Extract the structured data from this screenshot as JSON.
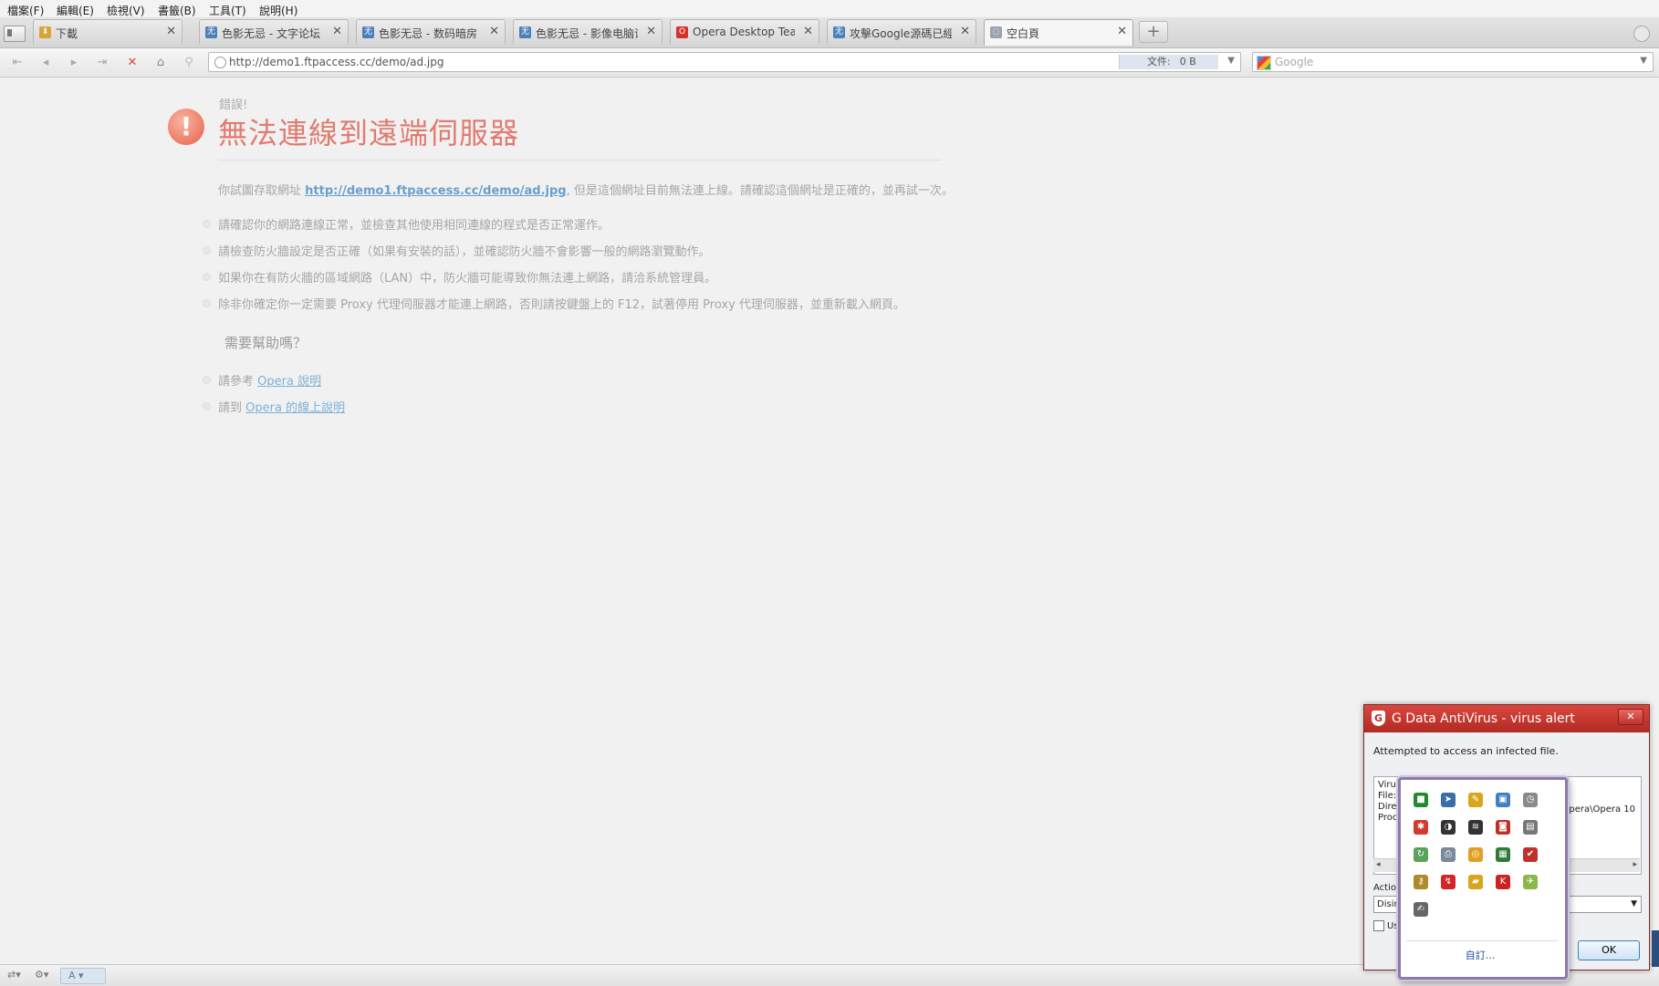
{
  "menu": [
    "檔案(F)",
    "編輯(E)",
    "檢視(V)",
    "書籤(B)",
    "工具(T)",
    "說明(H)"
  ],
  "tabs": [
    {
      "label": "下載",
      "icon": "download-icon",
      "color": "#d8a43a",
      "glyph": "⬇"
    },
    {
      "label": "色影无忌 - 文字论坛",
      "icon": "site-icon",
      "color": "#4b7fb8",
      "glyph": "无"
    },
    {
      "label": "色影无忌 - 数码暗房",
      "icon": "site-icon",
      "color": "#4b7fb8",
      "glyph": "无"
    },
    {
      "label": "色影无忌 - 影像电脑论...",
      "icon": "site-icon",
      "color": "#4b7fb8",
      "glyph": "无"
    },
    {
      "label": "Opera Desktop Tea...",
      "icon": "opera-icon",
      "color": "#d6322a",
      "glyph": "O"
    },
    {
      "label": "攻擊Google源碼已經...",
      "icon": "site-icon",
      "color": "#4b7fb8",
      "glyph": "无"
    },
    {
      "label": "空白頁",
      "icon": "blank-page-icon",
      "color": "#9aa3ad",
      "glyph": "◌"
    }
  ],
  "address": {
    "url": "http://demo1.ftpaccess.cc/demo/ad.jpg",
    "file_label": "文件:",
    "file_size": "0 B",
    "search_placeholder": "Google"
  },
  "error": {
    "small": "錯誤!",
    "title": "無法連線到遠端伺服器",
    "desc_before": "你試圖存取網址 ",
    "desc_link": "http://demo1.ftpaccess.cc/demo/ad.jpg",
    "desc_after": ", 但是這個網址目前無法連上線。請確認這個網址是正確的，並再試一次。",
    "bullets": [
      "請確認你的網路連線正常，並檢查其他使用相同連線的程式是否正常運作。",
      "請檢查防火牆設定是否正確（如果有安裝的話），並確認防火牆不會影響一般的網路瀏覽動作。",
      "如果你在有防火牆的區域網路（LAN）中，防火牆可能導致你無法連上網路，請洽系統管理員。",
      "除非你確定你一定需要 Proxy 代理伺服器才能連上網路，否則請按鍵盤上的 F12，試著停用 Proxy 代理伺服器，並重新載入網頁。"
    ],
    "help_title": "需要幫助嗎？",
    "help_items": [
      {
        "prefix": "請參考 ",
        "link": "Opera 說明"
      },
      {
        "prefix": "請到 ",
        "link": "Opera 的線上說明"
      }
    ]
  },
  "status": {
    "zoom_label": "A"
  },
  "gdata": {
    "title": "G Data AntiVirus - virus alert",
    "message": "Attempted to access an infected file.",
    "fields": [
      "Virus:",
      "File:",
      "Direc",
      "Proc"
    ],
    "path_fragment": "Opera\\Opera 10",
    "action_label": "Action",
    "action_value": "Disinf",
    "checkbox_label": "Us",
    "ok_label": "OK",
    "accent": "#c0302a"
  },
  "tray": {
    "customize_label": "自訂...",
    "icons": [
      {
        "name": "green-square-icon",
        "color": "#1f8a2e",
        "glyph": "■"
      },
      {
        "name": "arrow-app-icon",
        "color": "#3a6ea8",
        "glyph": "➤"
      },
      {
        "name": "pencil-app-icon",
        "color": "#d9a51f",
        "glyph": "✎"
      },
      {
        "name": "monitor-icon",
        "color": "#3f7fc2",
        "glyph": "▣"
      },
      {
        "name": "clock-icon",
        "color": "#8a8a8a",
        "glyph": "◷"
      },
      {
        "name": "bug-icon",
        "color": "#d23b2f",
        "glyph": "✱"
      },
      {
        "name": "ring-icon",
        "color": "#333333",
        "glyph": "◑"
      },
      {
        "name": "signal-icon",
        "color": "#333333",
        "glyph": "≋"
      },
      {
        "name": "shield-app-icon",
        "color": "#c0302a",
        "glyph": "◙"
      },
      {
        "name": "device-icon",
        "color": "#777777",
        "glyph": "▤"
      },
      {
        "name": "sync-icon",
        "color": "#5aa35a",
        "glyph": "↻"
      },
      {
        "name": "printer-icon",
        "color": "#7a8a9a",
        "glyph": "⎙"
      },
      {
        "name": "search-app-icon",
        "color": "#e0a020",
        "glyph": "◎"
      },
      {
        "name": "screen-icon",
        "color": "#2f7a3a",
        "glyph": "▦"
      },
      {
        "name": "check-app-icon",
        "color": "#c2302a",
        "glyph": "✔"
      },
      {
        "name": "key-icon",
        "color": "#b08a2a",
        "glyph": "⚷"
      },
      {
        "name": "chart-app-icon",
        "color": "#d32626",
        "glyph": "↯"
      },
      {
        "name": "folder-app-icon",
        "color": "#d9a51f",
        "glyph": "▰"
      },
      {
        "name": "kaspersky-icon",
        "color": "#cc2222",
        "glyph": "K"
      },
      {
        "name": "plane-icon",
        "color": "#8ab84a",
        "glyph": "✈"
      },
      {
        "name": "note-icon",
        "color": "#666666",
        "glyph": "✍"
      }
    ]
  }
}
